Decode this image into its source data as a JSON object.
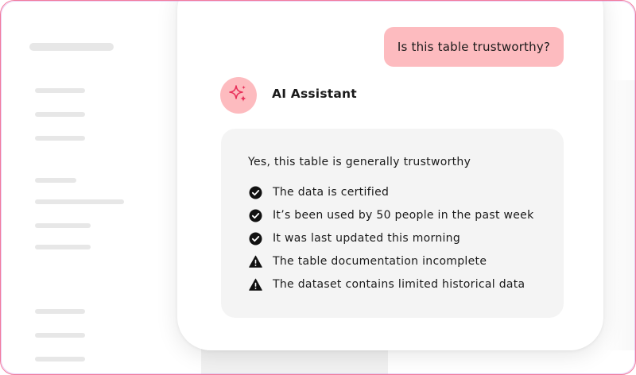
{
  "conversation": {
    "user_message": "Is this table trustworthy?",
    "assistant": {
      "name": "AI Assistant",
      "avatar_icon": "sparkle-icon",
      "answer_heading": "Yes, this table is generally trustworthy",
      "points": [
        {
          "text": "The data is certified",
          "icon": "check-circle-icon"
        },
        {
          "text": "It’s been used by 50 people in the past week",
          "icon": "check-circle-icon"
        },
        {
          "text": "It was last updated this morning",
          "icon": "check-circle-icon"
        },
        {
          "text": "The table documentation incomplete",
          "icon": "warning-icon"
        },
        {
          "text": "The dataset contains limited historical data",
          "icon": "warning-icon"
        }
      ]
    }
  },
  "colors": {
    "accent_pink": "#fdbbbf",
    "sparkle": "#e8305a",
    "frame_border": "#f27b9c",
    "text": "#1a1a1a"
  }
}
